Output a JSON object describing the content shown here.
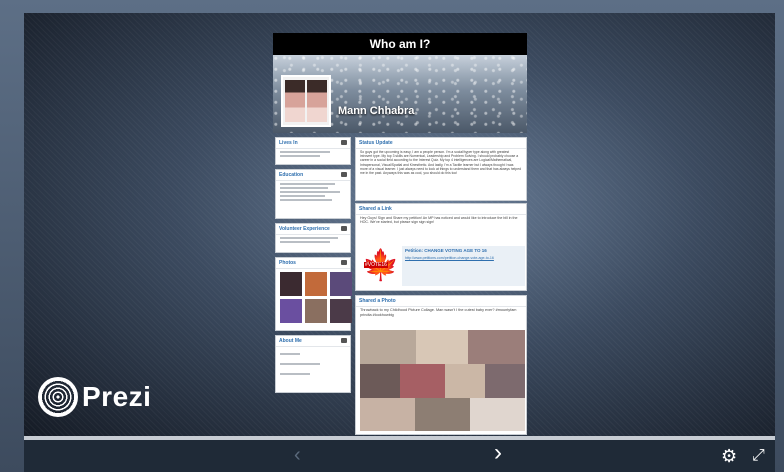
{
  "presentation": {
    "title": "Who am I?",
    "profile_name": "Mann Chhabra",
    "sections": {
      "lives_in": "Lives In",
      "education": "Education",
      "volunteer": "Volunteer Experience",
      "photos": "Photos",
      "about": "About Me",
      "status": "Status Update",
      "shared_link": "Shared a Link",
      "shared_photo": "Shared a Photo"
    },
    "status_text": "So guys got the upcoming is easy, I am a people person. I'm a social/hyper type along with greatest introvert type. My top 3 skills are Numerical, Leadership and Problem Solving. I should probably choose a career in a social field according to the Interest Quiz. My top 4 intelligences are Logical/Mathematical, Intrapersonal, Visual/Spatial and Kinesthetic. And lastly, I'm a Tactile learner but I always thought I was more of a visual learner. I just always need to look at things to understand them and that has always helped me in the past. Anyways this was as cool, you should do this too!",
    "link_text": "Hey Guys! Sign and Share my petition! An MP has noticed and would like to introduce the bill in the HOC. We've started, but please sign sign sign!",
    "petition_title": "Petition: CHANGE VOTING AGE TO 16",
    "petition_url": "http://www.petitions.com/petition-change-vote-age-to-16",
    "vote_badge": "#VOTE16",
    "photo_caption": "Throwback to my Childhood Picture Collage. Man wasn't I the cutest baby ever? #mountyfam prindta #lookhowbig"
  },
  "controls": {
    "prev_icon": "chevron-left-icon",
    "next_icon": "chevron-right-icon",
    "settings_icon": "gear-icon",
    "fullscreen_icon": "fullscreen-icon"
  },
  "brand": {
    "name": "Prezi"
  },
  "colors": {
    "accent": "#2f6fae",
    "title_bg": "#000000",
    "controls_bg": "#1f2a37"
  }
}
